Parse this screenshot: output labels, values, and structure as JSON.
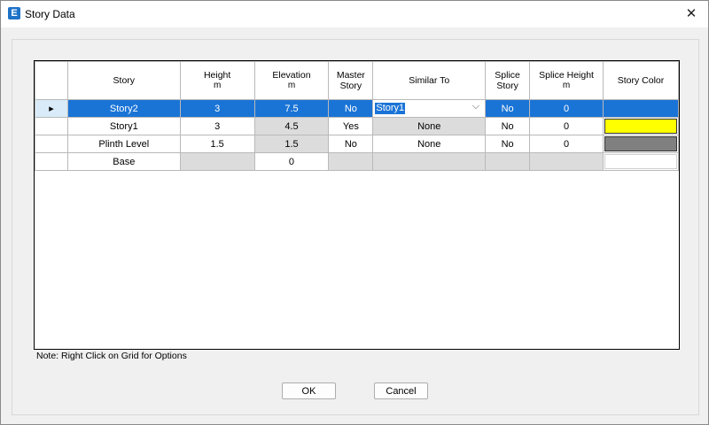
{
  "window": {
    "title": "Story Data",
    "app_icon_letter": "E",
    "close_glyph": "✕"
  },
  "grid": {
    "columns": [
      {
        "label": "Story",
        "unit": ""
      },
      {
        "label": "Height",
        "unit": "m"
      },
      {
        "label": "Elevation",
        "unit": "m"
      },
      {
        "label": "Master Story",
        "unit": ""
      },
      {
        "label": "Similar To",
        "unit": ""
      },
      {
        "label": "Splice Story",
        "unit": ""
      },
      {
        "label": "Splice Height",
        "unit": "m"
      },
      {
        "label": "Story Color",
        "unit": ""
      }
    ],
    "rows": [
      {
        "story": "Story2",
        "height": "3",
        "elevation": "7.5",
        "master": "No",
        "similar_to": "Story1",
        "splice": "No",
        "splice_height": "0",
        "color": "#1a74d6",
        "row_marker": "▸"
      },
      {
        "story": "Story1",
        "height": "3",
        "elevation": "4.5",
        "master": "Yes",
        "similar_to": "None",
        "splice": "No",
        "splice_height": "0",
        "color": "#ffff00"
      },
      {
        "story": "Plinth Level",
        "height": "1.5",
        "elevation": "1.5",
        "master": "No",
        "similar_to": "None",
        "splice": "No",
        "splice_height": "0",
        "color": "#808080"
      },
      {
        "story": "Base",
        "height": "",
        "elevation": "0",
        "master": "",
        "similar_to": "",
        "splice": "",
        "splice_height": "",
        "color": "#ffffff"
      }
    ]
  },
  "note": "Note:  Right Click on Grid for Options",
  "buttons": {
    "ok": "OK",
    "cancel": "Cancel"
  }
}
